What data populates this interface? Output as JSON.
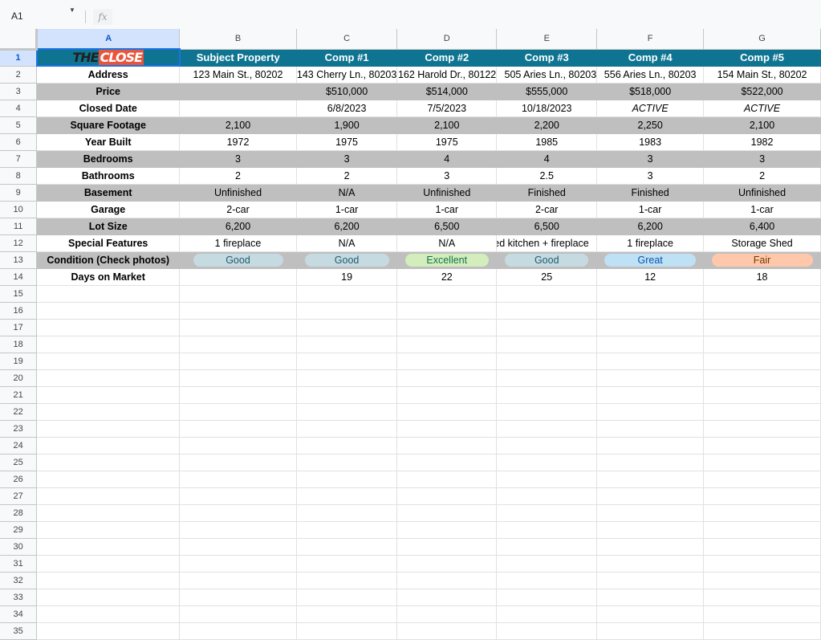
{
  "formula_bar": {
    "cell_ref": "A1",
    "fx_label": "fx"
  },
  "columns": [
    "A",
    "B",
    "C",
    "D",
    "E",
    "F",
    "G"
  ],
  "logo": {
    "part1": "THE",
    "part2": "CLOSE"
  },
  "rows": {
    "headers": [
      "Subject Property",
      "Comp #1",
      "Comp #2",
      "Comp #3",
      "Comp #4",
      "Comp #5"
    ],
    "address": {
      "label": "Address",
      "values": [
        "123 Main St., 80202",
        "143 Cherry Ln., 80203",
        "162 Harold Dr., 80122",
        "505 Aries Ln., 80203",
        "556 Aries Ln., 80203",
        "154 Main St., 80202"
      ]
    },
    "price": {
      "label": "Price",
      "values": [
        "",
        "$510,000",
        "$514,000",
        "$555,000",
        "$518,000",
        "$522,000"
      ]
    },
    "closed_date": {
      "label": "Closed Date",
      "values": [
        "",
        "6/8/2023",
        "7/5/2023",
        "10/18/2023",
        "ACTIVE",
        "ACTIVE"
      ]
    },
    "sqft": {
      "label": "Square Footage",
      "values": [
        "2,100",
        "1,900",
        "2,100",
        "2,200",
        "2,250",
        "2,100"
      ]
    },
    "year_built": {
      "label": "Year Built",
      "values": [
        "1972",
        "1975",
        "1975",
        "1985",
        "1983",
        "1982"
      ]
    },
    "bedrooms": {
      "label": "Bedrooms",
      "values": [
        "3",
        "3",
        "4",
        "4",
        "3",
        "3"
      ]
    },
    "bathrooms": {
      "label": "Bathrooms",
      "values": [
        "2",
        "2",
        "3",
        "2.5",
        "3",
        "2"
      ]
    },
    "basement": {
      "label": "Basement",
      "values": [
        "Unfinished",
        "N/A",
        "Unfinished",
        "Finished",
        "Finished",
        "Unfinished"
      ]
    },
    "garage": {
      "label": "Garage",
      "values": [
        "2-car",
        "1-car",
        "1-car",
        "2-car",
        "1-car",
        "1-car"
      ]
    },
    "lot_size": {
      "label": "Lot Size",
      "values": [
        "6,200",
        "6,200",
        "6,500",
        "6,500",
        "6,200",
        "6,400"
      ]
    },
    "special_features": {
      "label": "Special Features",
      "values": [
        "1 fireplace",
        "N/A",
        "N/A",
        "Renovated kitchen + fireplace",
        "1 fireplace",
        "Storage Shed"
      ]
    },
    "condition": {
      "label": "Condition (Check photos)",
      "values": [
        "Good",
        "Good",
        "Excellent",
        "Good",
        "Great",
        "Fair"
      ]
    },
    "days_on_market": {
      "label": "Days on Market",
      "values": [
        "",
        "19",
        "22",
        "25",
        "12",
        "18"
      ]
    }
  },
  "colors": {
    "header_bg": "#0f7491",
    "band_gray": "#bfbfbf",
    "logo_red": "#e8553b",
    "selection_blue": "#1a73e8"
  }
}
